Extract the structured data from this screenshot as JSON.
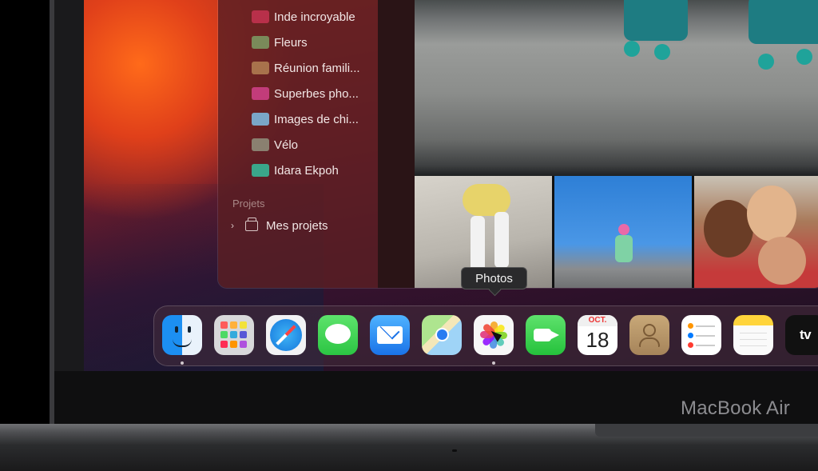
{
  "sidebar": {
    "albums": [
      {
        "label": "Inde incroyable",
        "thumb_color": "#b8304a"
      },
      {
        "label": "Fleurs",
        "thumb_color": "#7a8a5a"
      },
      {
        "label": "Réunion famili...",
        "thumb_color": "#a8724c"
      },
      {
        "label": "Superbes pho...",
        "thumb_color": "#c23c7a"
      },
      {
        "label": "Images de chi...",
        "thumb_color": "#7aa6c8"
      },
      {
        "label": "Vélo",
        "thumb_color": "#8a8070"
      },
      {
        "label": "Idara Ekpoh",
        "thumb_color": "#3aa68a"
      }
    ],
    "section_projects": "Projets",
    "projects_item": "Mes projets"
  },
  "tooltip": {
    "label": "Photos"
  },
  "dock": {
    "apps": [
      {
        "name": "Finder",
        "icon": "finder-icon"
      },
      {
        "name": "Launchpad",
        "icon": "launchpad-icon"
      },
      {
        "name": "Safari",
        "icon": "safari-icon"
      },
      {
        "name": "Messages",
        "icon": "messages-icon"
      },
      {
        "name": "Mail",
        "icon": "mail-icon"
      },
      {
        "name": "Plans",
        "icon": "maps-icon"
      },
      {
        "name": "Photos",
        "icon": "photos-icon"
      },
      {
        "name": "FaceTime",
        "icon": "facetime-icon"
      },
      {
        "name": "Calendrier",
        "icon": "calendar-icon"
      },
      {
        "name": "Contacts",
        "icon": "contacts-icon"
      },
      {
        "name": "Rappels",
        "icon": "reminders-icon"
      },
      {
        "name": "Notes",
        "icon": "notes-icon"
      },
      {
        "name": "TV",
        "icon": "tv-icon"
      }
    ],
    "calendar_month": "OCT.",
    "calendar_day": "18",
    "tv_label": "tv"
  },
  "device": {
    "brand_label": "MacBook Air"
  },
  "colors": {
    "sidebar_bg": "#5a1e23",
    "accent_orange": "#ff6a1a",
    "dock_bg": "#462d3c"
  }
}
